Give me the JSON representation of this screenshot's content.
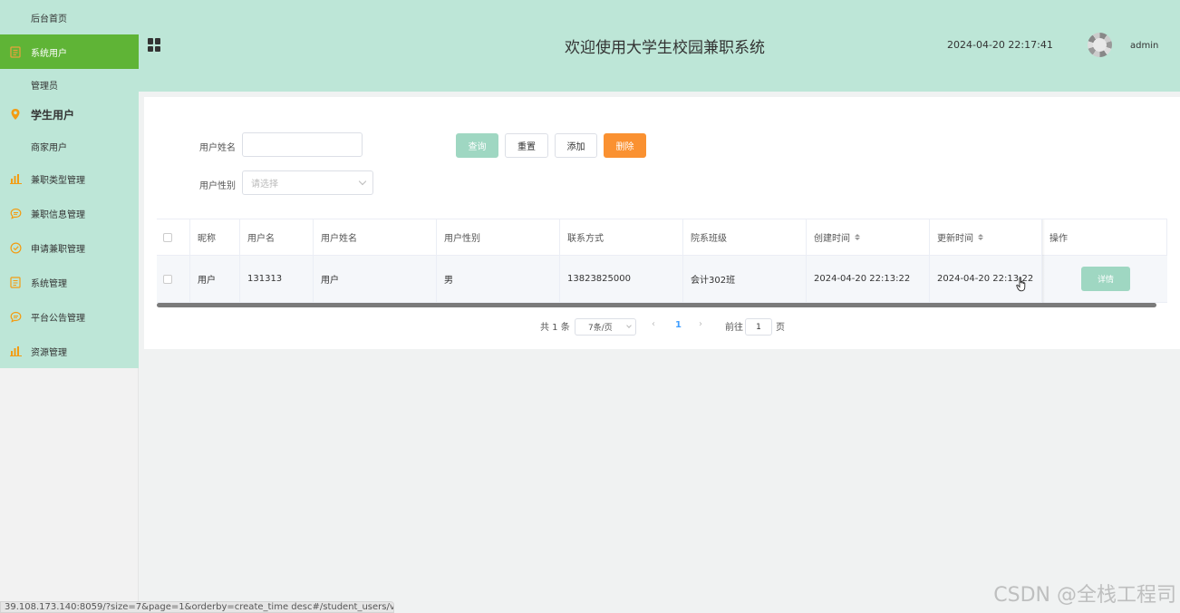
{
  "sidebar": {
    "items": [
      {
        "label": "后台首页",
        "icon": "none"
      },
      {
        "label": "系统用户",
        "icon": "document-icon",
        "active": true
      },
      {
        "label": "管理员",
        "icon": "none"
      },
      {
        "label": "学生用户",
        "icon": "location-pin-icon"
      },
      {
        "label": "商家用户",
        "icon": "none"
      },
      {
        "label": "兼职类型管理",
        "icon": "bar-chart-icon"
      },
      {
        "label": "兼职信息管理",
        "icon": "chat-bubble-icon"
      },
      {
        "label": "申请兼职管理",
        "icon": "check-circle-icon"
      },
      {
        "label": "系统管理",
        "icon": "document-icon"
      },
      {
        "label": "平台公告管理",
        "icon": "chat-bubble-icon"
      },
      {
        "label": "资源管理",
        "icon": "bar-chart-icon"
      }
    ]
  },
  "header": {
    "title": "欢迎使用大学生校园兼职系统",
    "datetime": "2024-04-20 22:17:41",
    "username": "admin"
  },
  "filters": {
    "name_label": "用户姓名",
    "name_value": "",
    "gender_label": "用户性别",
    "gender_placeholder": "请选择"
  },
  "buttons": {
    "query": "查询",
    "reset": "重置",
    "add": "添加",
    "delete": "删除"
  },
  "table": {
    "headers": [
      "昵称",
      "用户名",
      "用户姓名",
      "用户性别",
      "联系方式",
      "院系班级",
      "创建时间",
      "更新时间",
      "操作"
    ],
    "rows": [
      [
        "用户",
        "131313",
        "用户",
        "男",
        "13823825000",
        "会计302班",
        "2024-04-20 22:13:22",
        "2024-04-20 22:13:22"
      ]
    ],
    "detail_label": "详情"
  },
  "pagination": {
    "total": "共 1 条",
    "page_size": "7条/页",
    "prev": "‹",
    "current": "1",
    "next": "›",
    "goto_prefix": "前往",
    "goto_value": "1",
    "goto_suffix": "页"
  },
  "statusbar": "39.108.173.140:8059/?size=7&page=1&orderby=create_time desc#/student_users/vi...",
  "watermark": "CSDN @全栈工程司",
  "colors": {
    "sidebar_bg": "#bde6d7",
    "header_bg": "#bde6d7",
    "active_item": "#5fb436",
    "query_button": "#9fd7c2",
    "delete_button": "#fa9131",
    "icon_orange": "#f39c12"
  }
}
